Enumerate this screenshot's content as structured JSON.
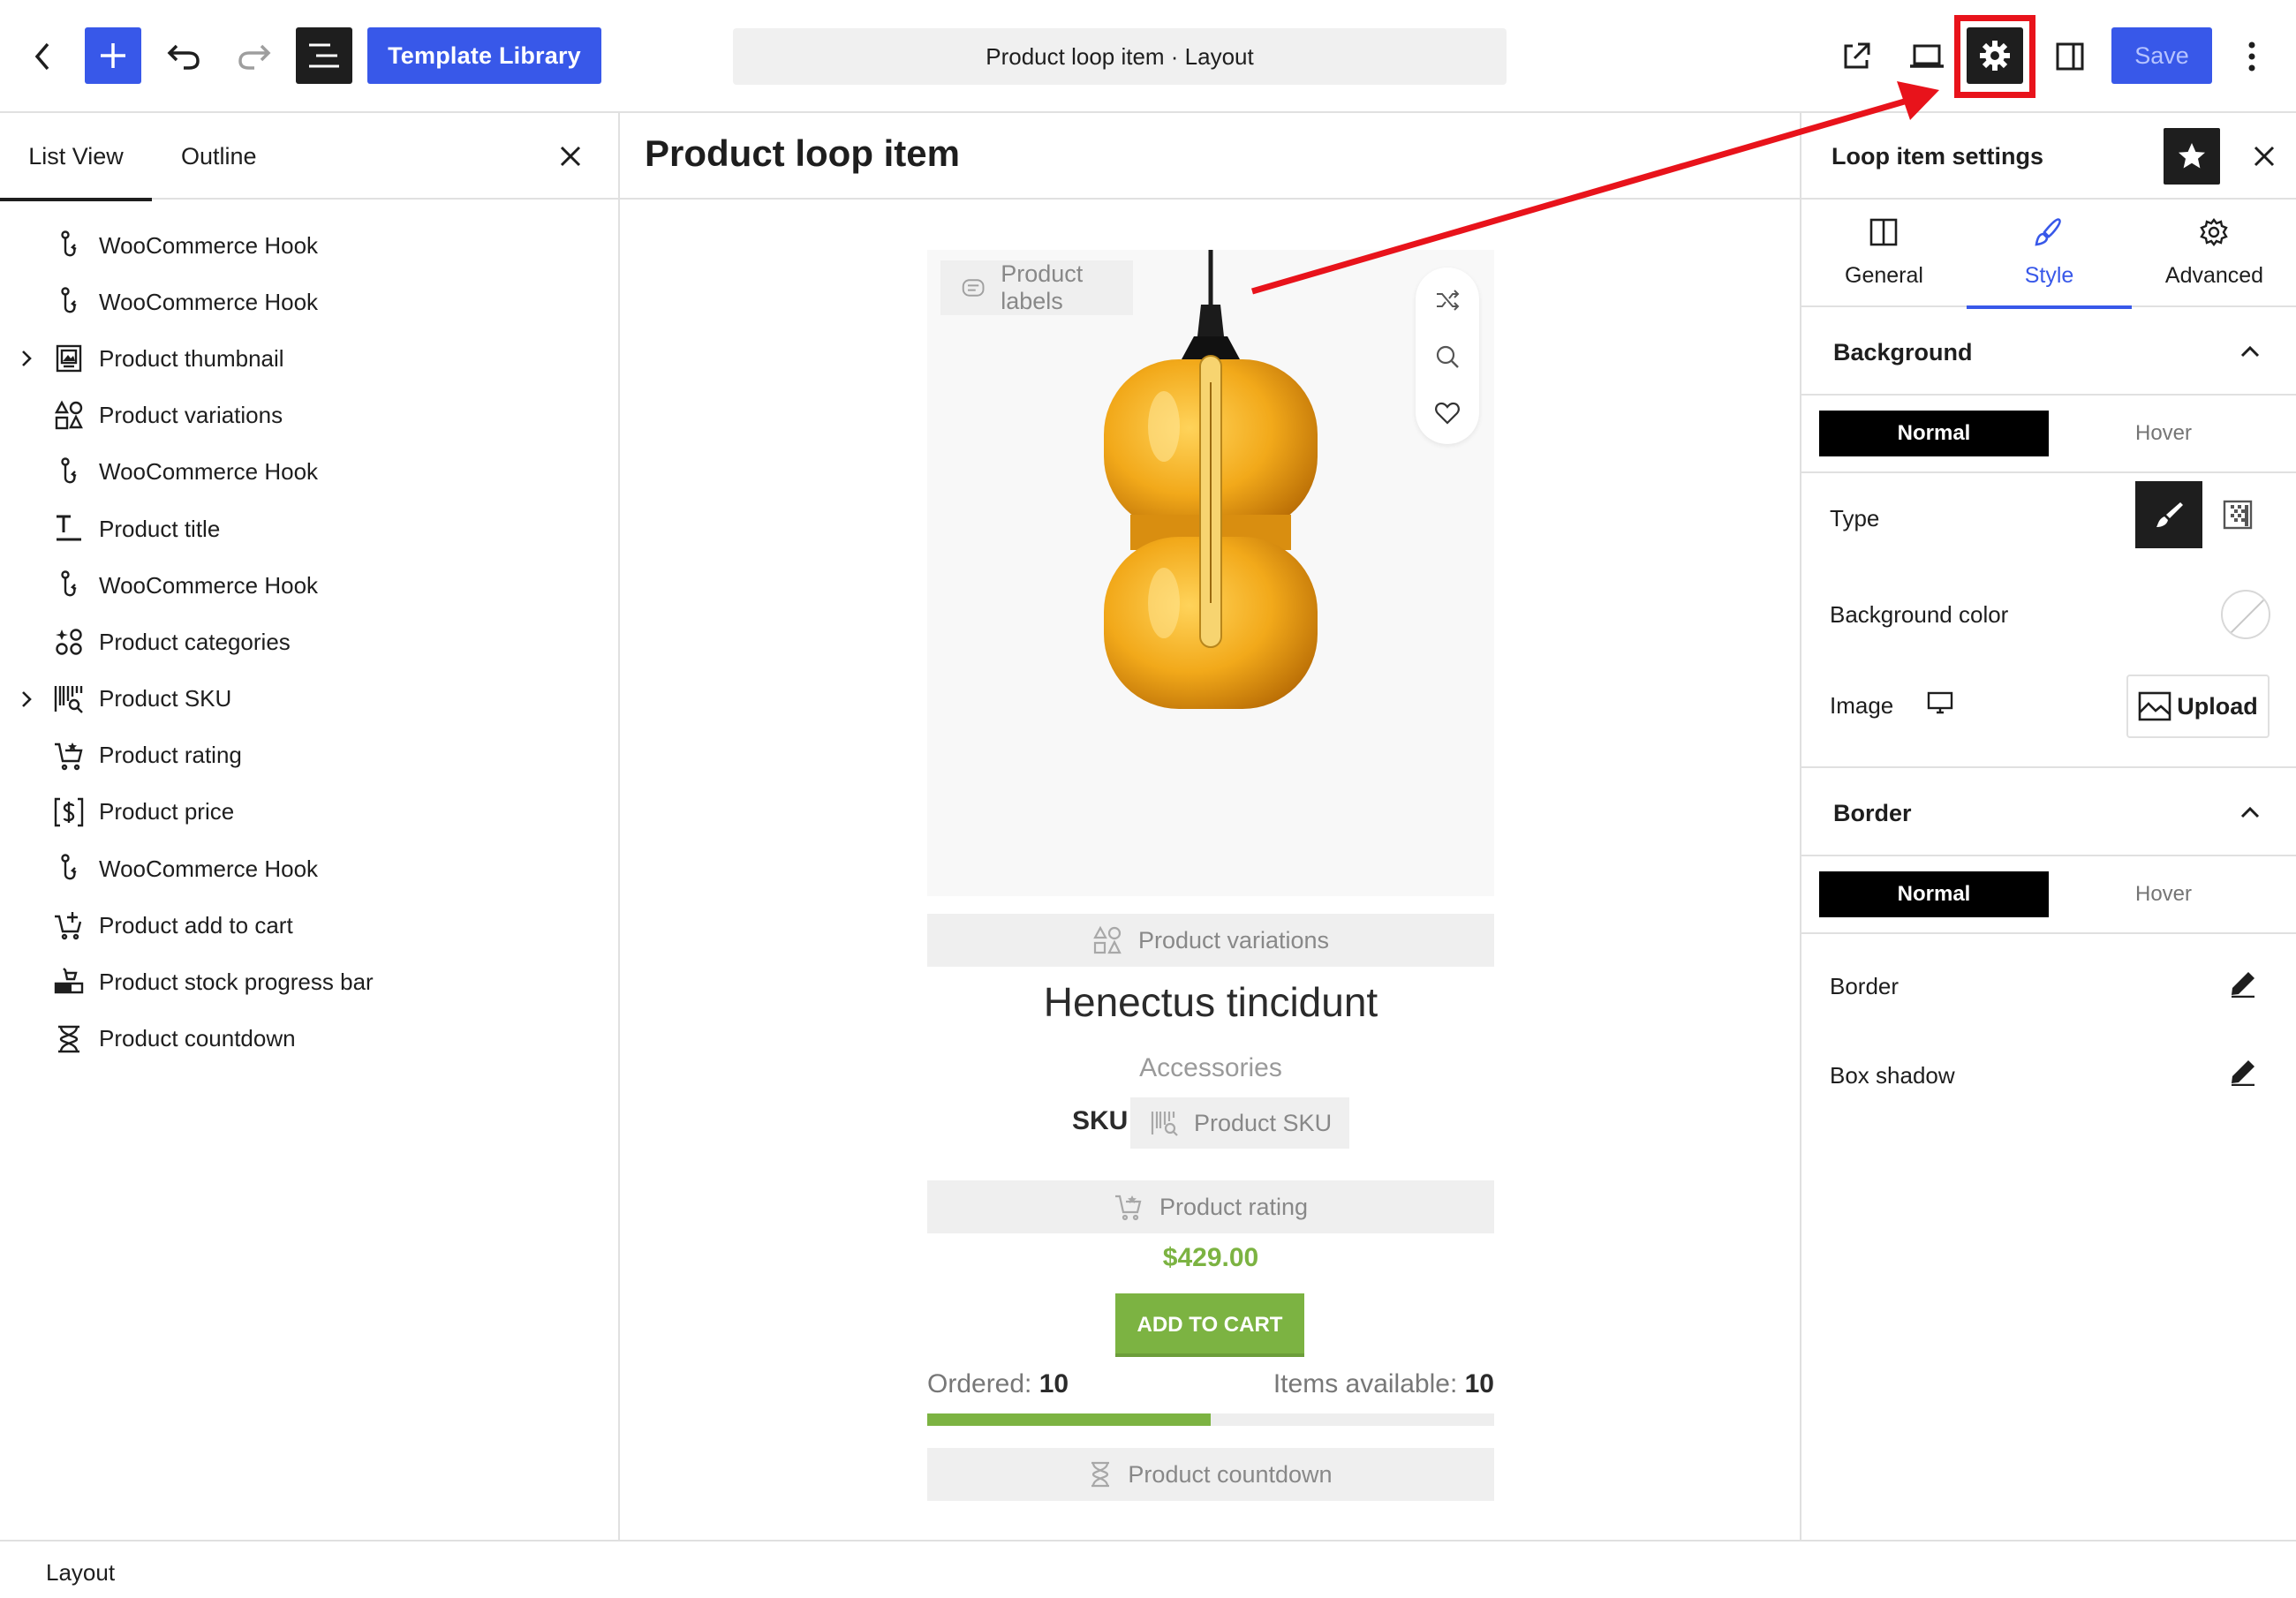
{
  "header": {
    "template_library_label": "Template Library",
    "document_title": "Product loop item · Layout",
    "save_label": "Save"
  },
  "left_panel": {
    "tabs": [
      {
        "label": "List View",
        "active": true
      },
      {
        "label": "Outline",
        "active": false
      }
    ],
    "items": [
      {
        "label": "WooCommerce Hook",
        "icon": "hook-icon",
        "expandable": false
      },
      {
        "label": "WooCommerce Hook",
        "icon": "hook-icon",
        "expandable": false
      },
      {
        "label": "Product thumbnail",
        "icon": "thumbnail-icon",
        "expandable": true
      },
      {
        "label": "Product variations",
        "icon": "variations-icon",
        "expandable": false
      },
      {
        "label": "WooCommerce Hook",
        "icon": "hook-icon",
        "expandable": false
      },
      {
        "label": "Product title",
        "icon": "title-icon",
        "expandable": false
      },
      {
        "label": "WooCommerce Hook",
        "icon": "hook-icon",
        "expandable": false
      },
      {
        "label": "Product categories",
        "icon": "categories-icon",
        "expandable": false
      },
      {
        "label": "Product SKU",
        "icon": "barcode-icon",
        "expandable": true
      },
      {
        "label": "Product rating",
        "icon": "rating-cart-icon",
        "expandable": false
      },
      {
        "label": "Product price",
        "icon": "price-icon",
        "expandable": false
      },
      {
        "label": "WooCommerce Hook",
        "icon": "hook-icon",
        "expandable": false
      },
      {
        "label": "Product add to cart",
        "icon": "add-to-cart-icon",
        "expandable": false
      },
      {
        "label": "Product stock progress bar",
        "icon": "stock-bar-icon",
        "expandable": false
      },
      {
        "label": "Product countdown",
        "icon": "hourglass-icon",
        "expandable": false
      }
    ]
  },
  "canvas": {
    "title": "Product loop item",
    "product_labels": "Product labels",
    "product_variations": "Product variations",
    "product_title": "Henectus tincidunt",
    "product_category": "Accessories",
    "sku_label": "SKU:",
    "sku_placeholder": "Product SKU",
    "rating_placeholder": "Product rating",
    "price": "$429.00",
    "add_to_cart": "ADD TO CART",
    "ordered_label": "Ordered:",
    "ordered_value": "10",
    "available_label": "Items available:",
    "available_value": "10",
    "stock_fraction": 0.5,
    "countdown_placeholder": "Product countdown"
  },
  "right_panel": {
    "title": "Loop item settings",
    "tabs": [
      {
        "label": "General",
        "active": false
      },
      {
        "label": "Style",
        "active": true
      },
      {
        "label": "Advanced",
        "active": false
      }
    ],
    "background": {
      "heading": "Background",
      "state_normal": "Normal",
      "state_hover": "Hover",
      "type_label": "Type",
      "color_label": "Background color",
      "image_label": "Image",
      "upload_label": "Upload"
    },
    "border": {
      "heading": "Border",
      "state_normal": "Normal",
      "state_hover": "Hover",
      "border_label": "Border",
      "shadow_label": "Box shadow"
    }
  },
  "footer": {
    "breadcrumb": "Layout"
  },
  "colors": {
    "accent": "#3858e9",
    "dark": "#1e1e1e",
    "price_green": "#7cb342",
    "annotation_red": "#e8131b"
  }
}
